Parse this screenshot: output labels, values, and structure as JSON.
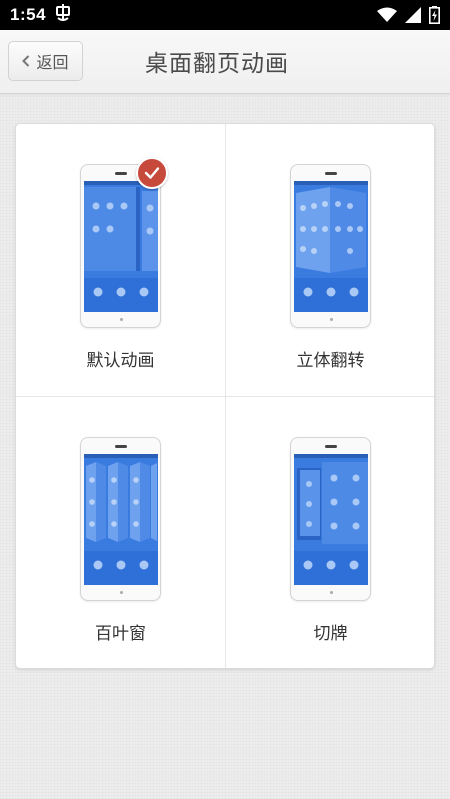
{
  "status_bar": {
    "time": "1:54",
    "notification_icon": "notification-glyph",
    "icons": [
      "wifi-icon",
      "signal-icon",
      "battery-charging-icon"
    ]
  },
  "header": {
    "back_label": "返回",
    "title": "桌面翻页动画"
  },
  "options": [
    {
      "label": "默认动画",
      "selected": true,
      "preview": "default"
    },
    {
      "label": "立体翻转",
      "selected": false,
      "preview": "cube"
    },
    {
      "label": "百叶窗",
      "selected": false,
      "preview": "blinds"
    },
    {
      "label": "切牌",
      "selected": false,
      "preview": "cards"
    }
  ],
  "colors": {
    "accent_check": "#c6493b",
    "screen_blue": "#3a7be0",
    "dock_blue": "#2f6fd8"
  }
}
